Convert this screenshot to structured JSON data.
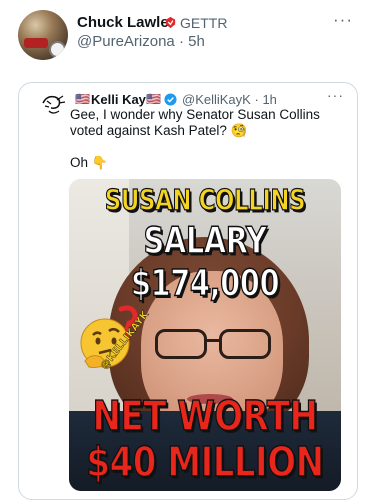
{
  "post": {
    "author_name": "Chuck Lawler",
    "platform_label": "GETTR",
    "handle": "@PureArizona",
    "separator": "·",
    "time": "5h",
    "more_icon": "more-horizontal-icon"
  },
  "quote": {
    "flag_left": "🇺🇸",
    "author_name": "Kelli Kay",
    "flag_right": "🇺🇸",
    "handle": "@KelliKayK",
    "separator": "·",
    "time": "1h",
    "text": "Gee, I wonder why Senator Susan Collins voted against Kash Patel? 🧐",
    "text2_prefix": "Oh",
    "text2_emoji": "👇",
    "verified_color": "#1d9bf0"
  },
  "meme": {
    "line1": "SUSAN COLLINS",
    "line2": "SALARY $174,000",
    "line3": "NET WORTH",
    "line4": "$40 MILLION",
    "watermark": "@KELLIKAYK",
    "colors": {
      "yellow": "#f5d421",
      "red": "#e8261c",
      "white": "#ffffff"
    }
  },
  "colors": {
    "text": "#0f1419",
    "muted": "#536471",
    "border": "#cfd9de",
    "gettr_red": "#e0292b"
  }
}
